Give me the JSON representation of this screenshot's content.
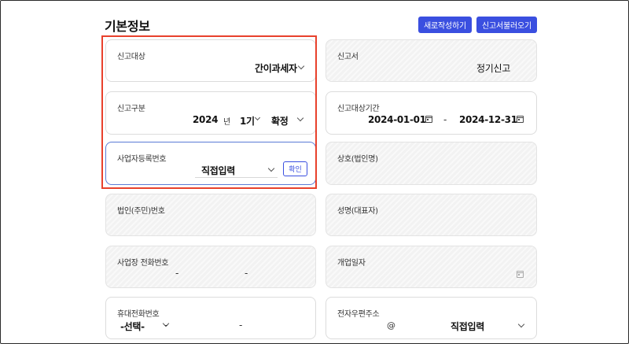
{
  "header": {
    "title": "기본정보",
    "new_button": "새로작성하기",
    "load_button": "신고서불러오기"
  },
  "fields": {
    "report_target": {
      "label": "신고대상",
      "value": "간이과세자"
    },
    "report_form": {
      "label": "신고서",
      "value": "정기신고"
    },
    "report_type": {
      "label": "신고구분",
      "year": "2024",
      "year_unit": "년",
      "period": "1기",
      "status": "확정"
    },
    "report_period": {
      "label": "신고대상기간",
      "start": "2024-01-01",
      "separator": "-",
      "end": "2024-12-31"
    },
    "business_number": {
      "label": "사업자등록번호",
      "mode": "직접입력",
      "confirm": "확인"
    },
    "company_name": {
      "label": "상호(법인명)"
    },
    "corp_number": {
      "label": "법인(주민)번호"
    },
    "representative": {
      "label": "성명(대표자)"
    },
    "business_phone": {
      "label": "사업장 전화번호",
      "sep1": "-",
      "sep2": "-"
    },
    "open_date": {
      "label": "개업일자"
    },
    "mobile": {
      "label": "휴대전화번호",
      "prefix": "-선택-",
      "sep1": "-",
      "sep2": "-"
    },
    "email": {
      "label": "전자우편주소",
      "at": "@",
      "domain_mode": "직접입력"
    }
  },
  "colors": {
    "accent": "#3a4fe0",
    "highlight": "#e8412c"
  }
}
